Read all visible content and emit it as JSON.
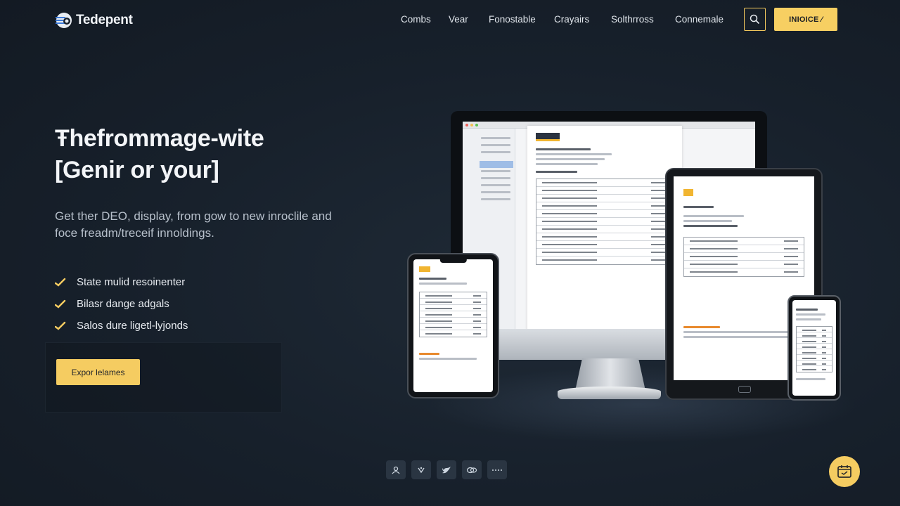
{
  "brand": {
    "name": "Tedepent"
  },
  "nav": {
    "items": [
      {
        "label": "Combs"
      },
      {
        "label": "Vear"
      },
      {
        "label": "Fonostable"
      },
      {
        "label": "Crayairs"
      },
      {
        "label": "Solthrross"
      },
      {
        "label": "Connemale"
      }
    ],
    "search_icon": "search-icon",
    "cta_label": "INIOICE ⁄"
  },
  "hero": {
    "title_line1": "Ŧhefrommage-wite",
    "title_line2": "[Genir or your]",
    "subtitle": "Get ther DEO, display, from gow to new inroclile and foce freadm/treceif innoldings.",
    "features": [
      {
        "label": "State mulid resoinenter"
      },
      {
        "label": "Bilasr dange adgals"
      },
      {
        "label": "Salos dure ligetl-lyjonds"
      }
    ],
    "cta_label": "Expor lelames"
  },
  "colors": {
    "background": "#17202b",
    "accent": "#f7cf62"
  },
  "socials": [
    {
      "icon": "person-icon"
    },
    {
      "icon": "link-icon"
    },
    {
      "icon": "twitter-icon"
    },
    {
      "icon": "chat-bubbles-icon"
    },
    {
      "icon": "dots-icon"
    }
  ],
  "chat_widget_icon": "calendar-chat-icon"
}
